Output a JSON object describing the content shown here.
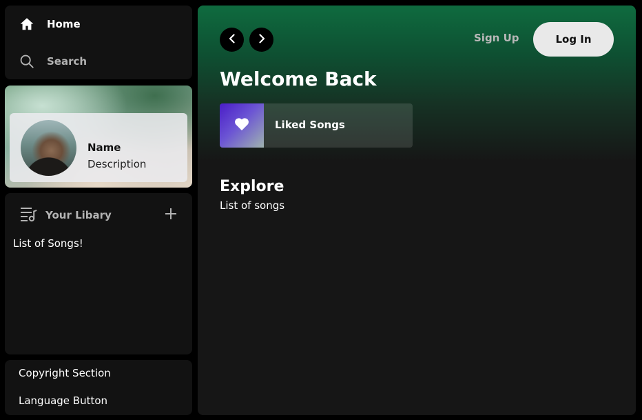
{
  "sidebar": {
    "nav": {
      "home_label": "Home",
      "search_label": "Search"
    },
    "profile": {
      "name": "Name",
      "description": "Description"
    },
    "library": {
      "title": "Your Libary",
      "list_text": "List of Songs!"
    },
    "footer": {
      "copyright": "Copyright Section",
      "language": "Language Button"
    }
  },
  "header": {
    "signup_label": "Sign Up",
    "login_label": "Log In"
  },
  "main": {
    "welcome_title": "Welcome Back",
    "liked_songs_label": "Liked Songs",
    "explore_title": "Explore",
    "explore_subtitle": "List of songs"
  },
  "colors": {
    "accent_green": "#0f6b3f",
    "panel_bg": "#121212",
    "liked_gradient_start": "#4a1dc7",
    "login_button_bg": "#e9e9e9"
  },
  "icons": {
    "home": "home-icon",
    "search": "search-icon",
    "library": "library-icon",
    "add": "plus-icon",
    "back": "chevron-left-icon",
    "forward": "chevron-right-icon",
    "liked": "heart-icon"
  }
}
